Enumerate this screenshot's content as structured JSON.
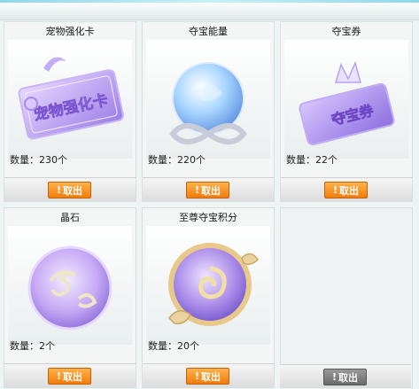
{
  "quantity_label": "数量：",
  "items": [
    {
      "name": "宠物强化卡",
      "quantity": "230个",
      "button": "取出",
      "card_text": "宠物强化卡"
    },
    {
      "name": "夺宝能量",
      "quantity": "220个",
      "button": "取出"
    },
    {
      "name": "夺宝券",
      "quantity": "22个",
      "button": "取出",
      "card_text": "夺宝券"
    },
    {
      "name": "晶石",
      "quantity": "2个",
      "button": "取出"
    },
    {
      "name": "至尊夺宝积分",
      "quantity": "20个",
      "button": "取出"
    }
  ],
  "empty_slot": {
    "button": "取出"
  },
  "colors": {
    "button_orange": "#f07d0c",
    "button_gray": "#6a6a6a"
  }
}
